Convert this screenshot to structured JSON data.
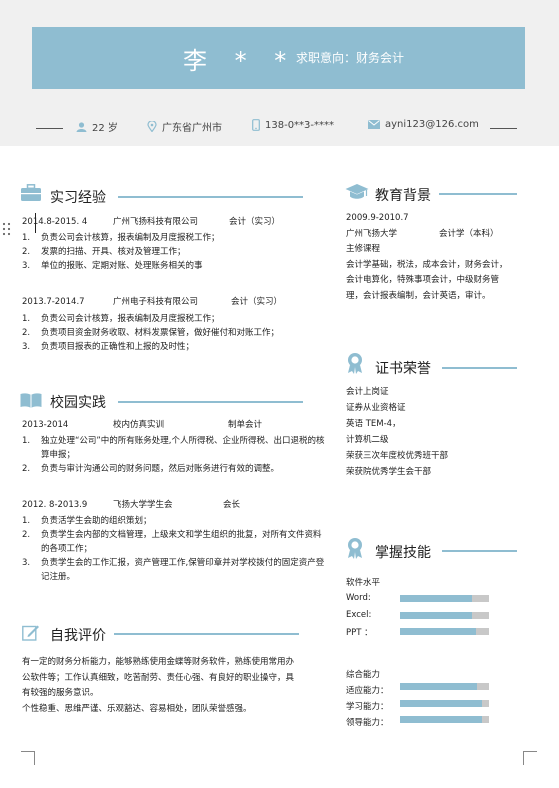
{
  "header": {
    "name": "李 * *",
    "intent": "求职意向：财务会计",
    "age": "22 岁",
    "location": "广东省广州市",
    "phone": "138-0**3-****",
    "email": "ayni123@126.com"
  },
  "internship": {
    "title": "实习经验",
    "entries": [
      {
        "period": "2014.8-2015. 4",
        "org": "广州飞扬科技有限公司",
        "role": "会计（实习）",
        "items": [
          "负责公司会计核算，报表编制及月度报税工作；",
          "发票的扫描、开具、核对及管理工作；",
          "单位的报账、定期对账、处理账务相关的事"
        ]
      },
      {
        "period": "2013.7-2014.7",
        "org": "广州电子科技有限公司",
        "role": "会计（实习）",
        "items": [
          "负责公司会计核算，报表编制及月度报税工作；",
          "负责项目资金财务收取、材料发票保管，做好催付和对账工作；",
          "负责项目报表的正确性和上报的及时性；"
        ]
      }
    ]
  },
  "campus": {
    "title": "校园实践",
    "entries": [
      {
        "period": "2013-2014",
        "org": "校内仿真实训",
        "role": "制单会计",
        "items": [
          "独立处理“公司”中的所有账务处理,个人所得税、企业所得税、出口退税的核算申报；",
          "负责与审计沟通公司的财务问题，然后对账务进行有效的调整。"
        ]
      },
      {
        "period": "2012. 8-2013.9",
        "org": "飞扬大学学生会",
        "role": "会长",
        "items": [
          "负责活学生会助的组织策划；",
          "负责学生会内部的文档管理，上级来文和学生组织的批复，对所有文件资料的各项工作；",
          "负责学生会的工作汇报，资产管理工作,保管印章并对学校拨付的固定资产登记注册。"
        ]
      }
    ]
  },
  "self_eval": {
    "title": "自我评价",
    "lines": [
      "有一定的财务分析能力，能够熟练使用金蝶等财务软件，熟练使用常用办",
      "公软件等；工作认真细致，吃苦耐劳、责任心强、有良好的职业操守，具",
      "有较强的服务意识。",
      "个性稳重、思维严谨、乐观豁达、容易相处，团队荣誉感强。"
    ]
  },
  "education": {
    "title": "教育背景",
    "period": "2009.9-2010.7",
    "school": "广州飞扬大学",
    "major": "会计学（本科）",
    "courses_label": "主修课程",
    "courses": [
      "会计学基础，税法，成本会计，财务会计，",
      "会计电算化，特殊事项会计，中级财务管",
      "理，会计报表编制，会计英语，审计。"
    ]
  },
  "certificates": {
    "title": "证书荣誉",
    "items": [
      "会计上岗证",
      "证券从业资格证",
      "英语 TEM-4，",
      "计算机二级",
      "荣获三次年度校优秀班干部",
      "荣获院优秀学生会干部"
    ]
  },
  "skills": {
    "title": "掌握技能",
    "software_title": "软件水平",
    "software": [
      {
        "name": "Word:",
        "level": 0.81
      },
      {
        "name": "Excel:",
        "level": 0.81
      },
      {
        "name": "PPT ：",
        "level": 0.85
      }
    ],
    "overall_title": "综合能力",
    "overall": [
      {
        "name": "适应能力：",
        "level": 0.86
      },
      {
        "name": "学习能力：",
        "level": 0.92
      },
      {
        "name": "领导能力：",
        "level": 0.92
      }
    ]
  },
  "colors": {
    "accent": "#8fbdd1",
    "band": "#f0f0f0",
    "bar_track": "#c8c8c8"
  }
}
